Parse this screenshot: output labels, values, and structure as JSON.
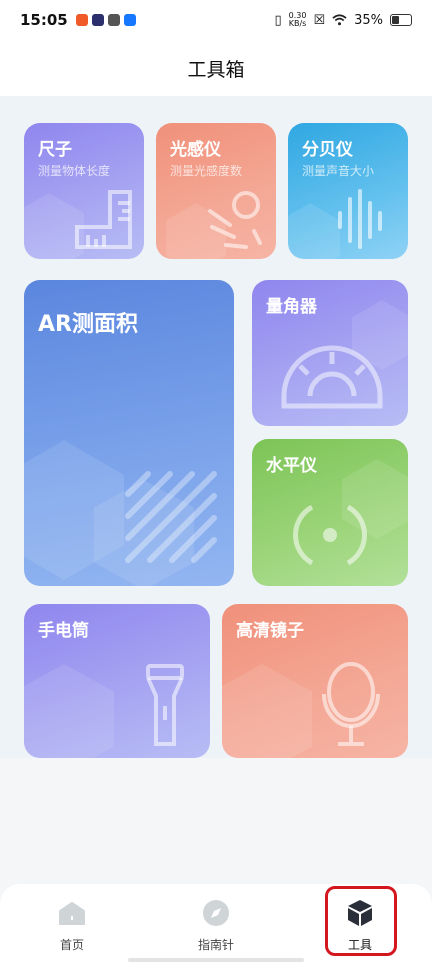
{
  "status_bar": {
    "time": "15:05",
    "net_speed_value": "0.30",
    "net_speed_unit": "KB/s",
    "battery": "35%"
  },
  "header": {
    "title": "工具箱"
  },
  "tools": {
    "ruler": {
      "title": "尺子",
      "subtitle": "测量物体长度"
    },
    "light_meter": {
      "title": "光感仪",
      "subtitle": "测量光感度数"
    },
    "decibel_meter": {
      "title": "分贝仪",
      "subtitle": "测量声音大小"
    },
    "ar_area": {
      "title": "AR测面积"
    },
    "protractor": {
      "title": "量角器"
    },
    "level": {
      "title": "水平仪"
    },
    "flashlight": {
      "title": "手电筒"
    },
    "mirror": {
      "title": "高清镜子"
    }
  },
  "tabs": [
    {
      "label": "首页",
      "icon": "home-icon"
    },
    {
      "label": "指南针",
      "icon": "compass-icon"
    },
    {
      "label": "工具",
      "icon": "toolbox-icon"
    }
  ],
  "colors": {
    "purple": "#8f86ee",
    "salmon": "#f0907a",
    "blue": "#2fa7e2",
    "green": "#7cc456",
    "highlight": "#d4161e"
  }
}
